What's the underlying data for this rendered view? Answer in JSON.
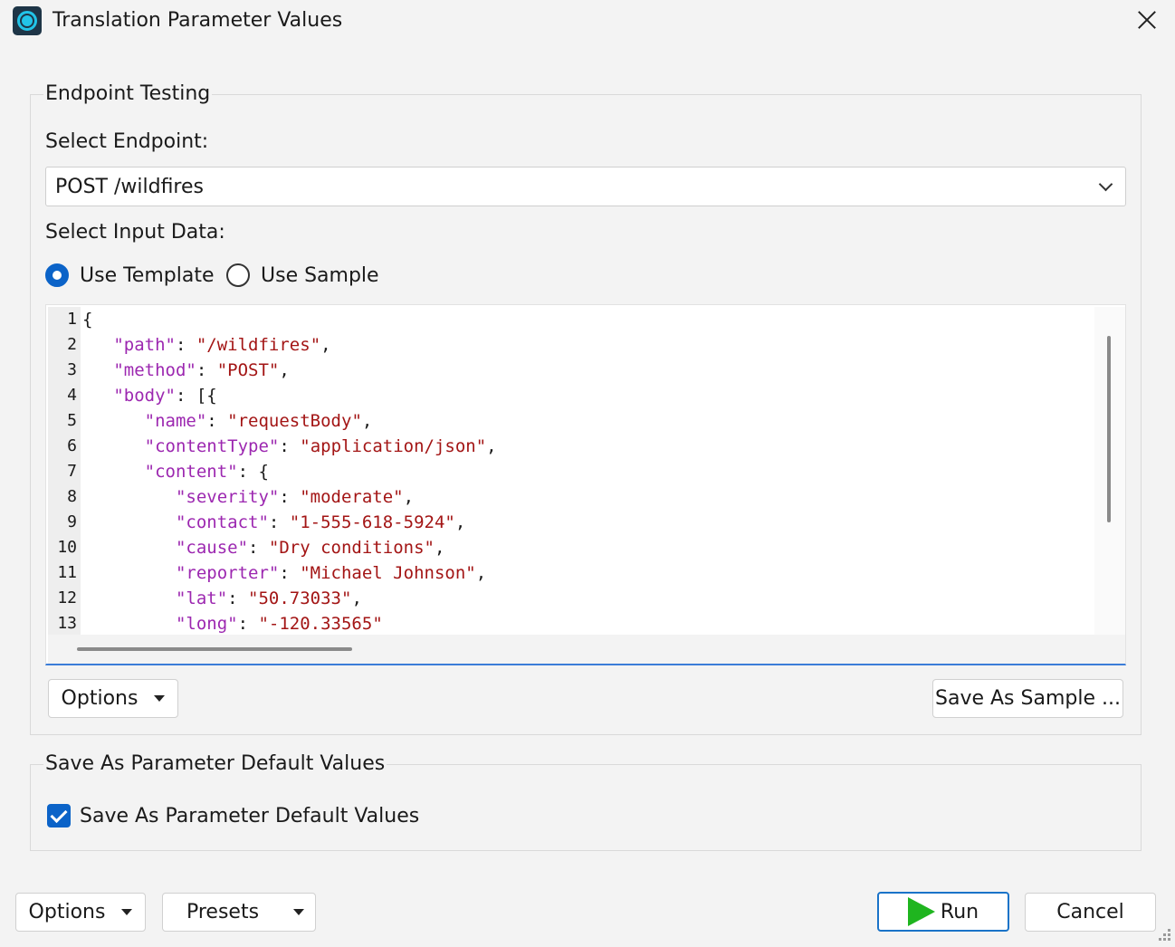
{
  "window": {
    "title": "Translation Parameter Values",
    "app_icon": "app-logo-icon",
    "close_icon": "close-icon"
  },
  "endpoint_testing": {
    "legend": "Endpoint Testing",
    "select_endpoint_label": "Select Endpoint:",
    "endpoint_value": "POST /wildfires",
    "select_input_label": "Select Input Data:",
    "radio_template": "Use Template",
    "radio_sample": "Use Sample",
    "selected_input": "Use Template",
    "options_label": "Options",
    "save_sample_label": "Save As Sample ..."
  },
  "editor": {
    "lines": [
      {
        "num": "1",
        "tokens": [
          {
            "t": "{",
            "c": "p"
          }
        ]
      },
      {
        "num": "2",
        "tokens": [
          {
            "t": "   ",
            "c": "p"
          },
          {
            "t": "\"path\"",
            "c": "k"
          },
          {
            "t": ": ",
            "c": "p"
          },
          {
            "t": "\"/wildfires\"",
            "c": "s"
          },
          {
            "t": ",",
            "c": "p"
          }
        ]
      },
      {
        "num": "3",
        "tokens": [
          {
            "t": "   ",
            "c": "p"
          },
          {
            "t": "\"method\"",
            "c": "k"
          },
          {
            "t": ": ",
            "c": "p"
          },
          {
            "t": "\"POST\"",
            "c": "s"
          },
          {
            "t": ",",
            "c": "p"
          }
        ]
      },
      {
        "num": "4",
        "tokens": [
          {
            "t": "   ",
            "c": "p"
          },
          {
            "t": "\"body\"",
            "c": "k"
          },
          {
            "t": ": [{",
            "c": "p"
          }
        ]
      },
      {
        "num": "5",
        "tokens": [
          {
            "t": "      ",
            "c": "p"
          },
          {
            "t": "\"name\"",
            "c": "k"
          },
          {
            "t": ": ",
            "c": "p"
          },
          {
            "t": "\"requestBody\"",
            "c": "s"
          },
          {
            "t": ",",
            "c": "p"
          }
        ]
      },
      {
        "num": "6",
        "tokens": [
          {
            "t": "      ",
            "c": "p"
          },
          {
            "t": "\"contentType\"",
            "c": "k"
          },
          {
            "t": ": ",
            "c": "p"
          },
          {
            "t": "\"application/json\"",
            "c": "s"
          },
          {
            "t": ",",
            "c": "p"
          }
        ]
      },
      {
        "num": "7",
        "tokens": [
          {
            "t": "      ",
            "c": "p"
          },
          {
            "t": "\"content\"",
            "c": "k"
          },
          {
            "t": ": {",
            "c": "p"
          }
        ]
      },
      {
        "num": "8",
        "tokens": [
          {
            "t": "         ",
            "c": "p"
          },
          {
            "t": "\"severity\"",
            "c": "k"
          },
          {
            "t": ": ",
            "c": "p"
          },
          {
            "t": "\"moderate\"",
            "c": "s"
          },
          {
            "t": ",",
            "c": "p"
          }
        ]
      },
      {
        "num": "9",
        "tokens": [
          {
            "t": "         ",
            "c": "p"
          },
          {
            "t": "\"contact\"",
            "c": "k"
          },
          {
            "t": ": ",
            "c": "p"
          },
          {
            "t": "\"1-555-618-5924\"",
            "c": "s"
          },
          {
            "t": ",",
            "c": "p"
          }
        ]
      },
      {
        "num": "10",
        "tokens": [
          {
            "t": "         ",
            "c": "p"
          },
          {
            "t": "\"cause\"",
            "c": "k"
          },
          {
            "t": ": ",
            "c": "p"
          },
          {
            "t": "\"Dry conditions\"",
            "c": "s"
          },
          {
            "t": ",",
            "c": "p"
          }
        ]
      },
      {
        "num": "11",
        "tokens": [
          {
            "t": "         ",
            "c": "p"
          },
          {
            "t": "\"reporter\"",
            "c": "k"
          },
          {
            "t": ": ",
            "c": "p"
          },
          {
            "t": "\"Michael Johnson\"",
            "c": "s"
          },
          {
            "t": ",",
            "c": "p"
          }
        ]
      },
      {
        "num": "12",
        "tokens": [
          {
            "t": "         ",
            "c": "p"
          },
          {
            "t": "\"lat\"",
            "c": "k"
          },
          {
            "t": ": ",
            "c": "p"
          },
          {
            "t": "\"50.73033\"",
            "c": "s"
          },
          {
            "t": ",",
            "c": "p"
          }
        ]
      },
      {
        "num": "13",
        "tokens": [
          {
            "t": "         ",
            "c": "p"
          },
          {
            "t": "\"long\"",
            "c": "k"
          },
          {
            "t": ": ",
            "c": "p"
          },
          {
            "t": "\"-120.33565\"",
            "c": "s"
          }
        ]
      }
    ]
  },
  "defaults_group": {
    "legend": "Save As Parameter Default Values",
    "checkbox_label": "Save As Parameter Default Values",
    "checked": true
  },
  "footer": {
    "options_label": "Options",
    "presets_label": "Presets",
    "run_label": "Run",
    "cancel_label": "Cancel"
  },
  "colors": {
    "key": "#9c27b0",
    "string": "#a31515",
    "accent": "#0b63c8",
    "run_play": "#1fb51f"
  }
}
